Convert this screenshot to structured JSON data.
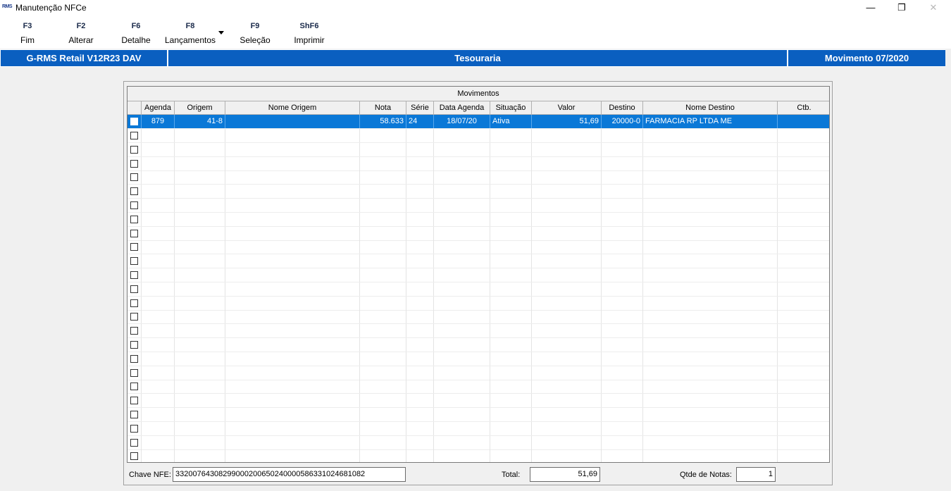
{
  "window": {
    "logo": "RMS",
    "title": "Manutenção NFCe",
    "minimize_glyph": "—",
    "restore_glyph": "❐",
    "close_glyph": "✕"
  },
  "toolbar": {
    "buttons": [
      {
        "key": "F3",
        "label": "Fim"
      },
      {
        "key": "F2",
        "label": "Alterar"
      },
      {
        "key": "F6",
        "label": "Detalhe"
      },
      {
        "key": "F8",
        "label": "Lançamentos"
      },
      {
        "key": "F9",
        "label": "Seleção"
      },
      {
        "key": "ShF6",
        "label": "Imprimir"
      }
    ]
  },
  "infobar": {
    "left": "G-RMS Retail V12R23 DAV",
    "center": "Tesouraria",
    "right": "Movimento 07/2020"
  },
  "grid": {
    "title": "Movimentos",
    "columns": [
      "",
      "Agenda",
      "Origem",
      "Nome Origem",
      "Nota",
      "Série",
      "Data Agenda",
      "Situação",
      "Valor",
      "Destino",
      "Nome Destino",
      "Ctb."
    ],
    "rows": [
      {
        "agenda": "879",
        "origem": "41-8",
        "nome_origem": "",
        "nota": "58.633",
        "serie": "24",
        "data_agenda": "18/07/20",
        "situacao": "Ativa",
        "valor": "51,69",
        "destino": "20000-0",
        "nome_destino": "FARMACIA RP LTDA ME",
        "ctb": ""
      }
    ],
    "empty_rows": 24
  },
  "footer": {
    "chave_label": "Chave NFE:",
    "chave_value": "33200764308299000200650240000586331024681082",
    "total_label": "Total:",
    "total_value": "51,69",
    "qtde_label": "Qtde de Notas:",
    "qtde_value": "1"
  }
}
